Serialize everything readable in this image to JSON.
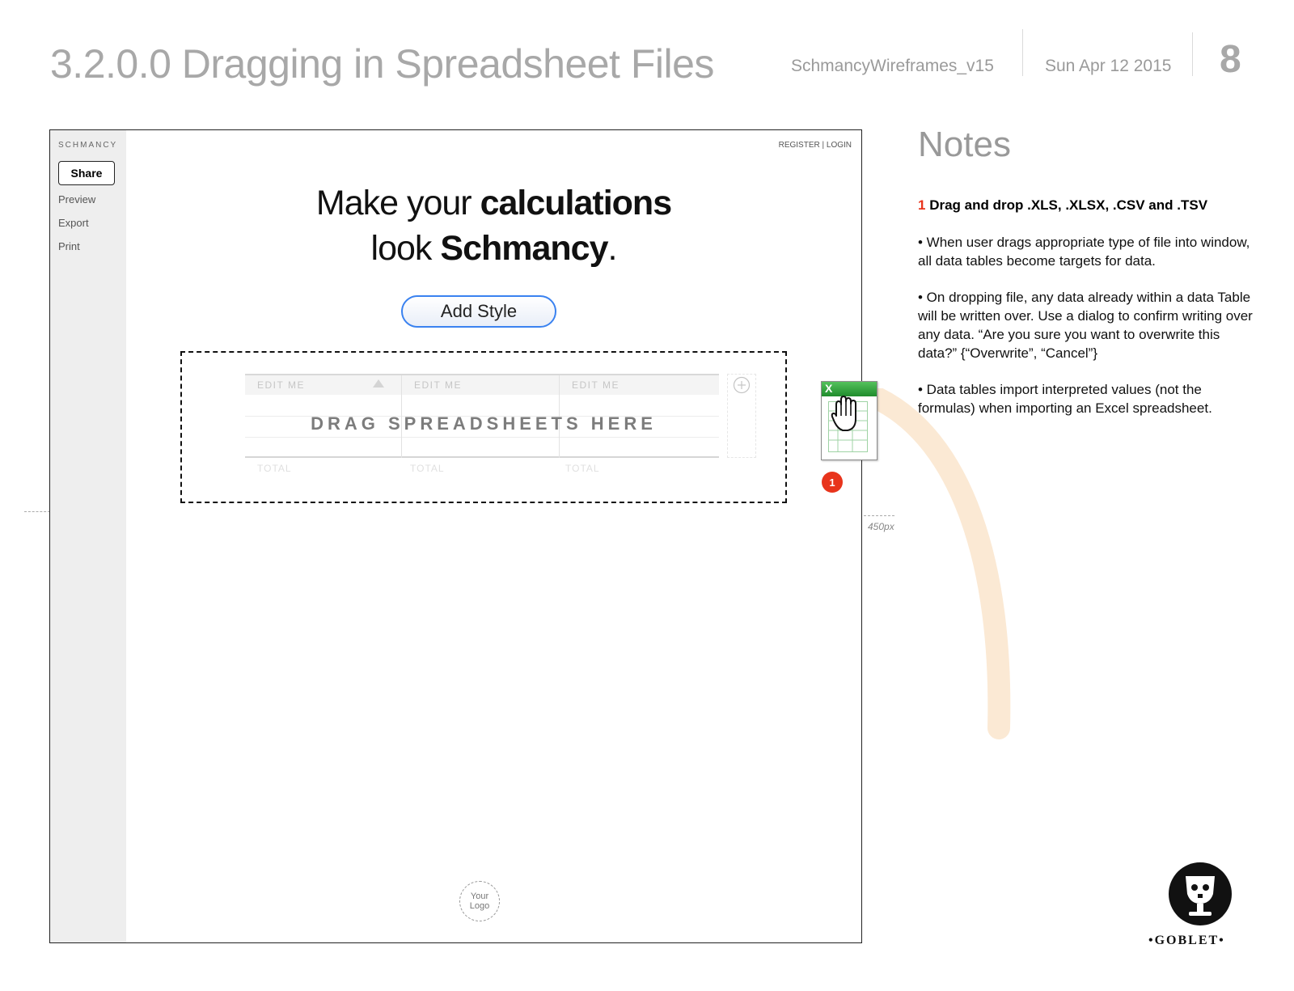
{
  "header": {
    "title": "3.2.0.0 Dragging in Spreadsheet Files",
    "document_name": "SchmancyWireframes_v15",
    "date": "Sun Apr 12 2015",
    "page_number": "8"
  },
  "app": {
    "brand": "SCHMANCY",
    "share_label": "Share",
    "nav": [
      "Preview",
      "Export",
      "Print"
    ],
    "auth_link": "REGISTER | LOGIN",
    "hero_line1_light": "Make your ",
    "hero_line1_bold": "calculations",
    "hero_line2_light": "look ",
    "hero_line2_bold": "Schmancy",
    "hero_line2_end": ".",
    "add_style_label": "Add Style",
    "drop_zone_text": "DRAG SPREADSHEETS HERE",
    "table_columns": [
      "EDIT ME",
      "EDIT ME",
      "EDIT ME"
    ],
    "table_totals": [
      "TOTAL",
      "TOTAL",
      "TOTAL"
    ],
    "logo_line1": "Your",
    "logo_line2": "Logo"
  },
  "annotations": {
    "marker_number": "1",
    "dimension_label": "450px",
    "file_icon_letter": "X"
  },
  "notes": {
    "title": "Notes",
    "heading_number": "1",
    "heading_text": "Drag and drop .XLS, .XLSX, .CSV and .TSV",
    "items": [
      "• When user drags appropriate type of file into window, all data tables become targets for data.",
      "• On dropping file, any data already within a data Table will be written over. Use a dialog to confirm writing over any data. “Are you sure you want to overwrite this data?” {“Overwrite”, “Cancel”}",
      "• Data tables import interpreted values (not the formulas) when importing an Excel spreadsheet."
    ]
  },
  "footer": {
    "brand": "•GOBLET•"
  },
  "colors": {
    "accent_blue": "#3a82f0",
    "marker_red": "#e8341c",
    "drag_path": "#fbe9d4",
    "excel_green": "#2e9e3a"
  }
}
